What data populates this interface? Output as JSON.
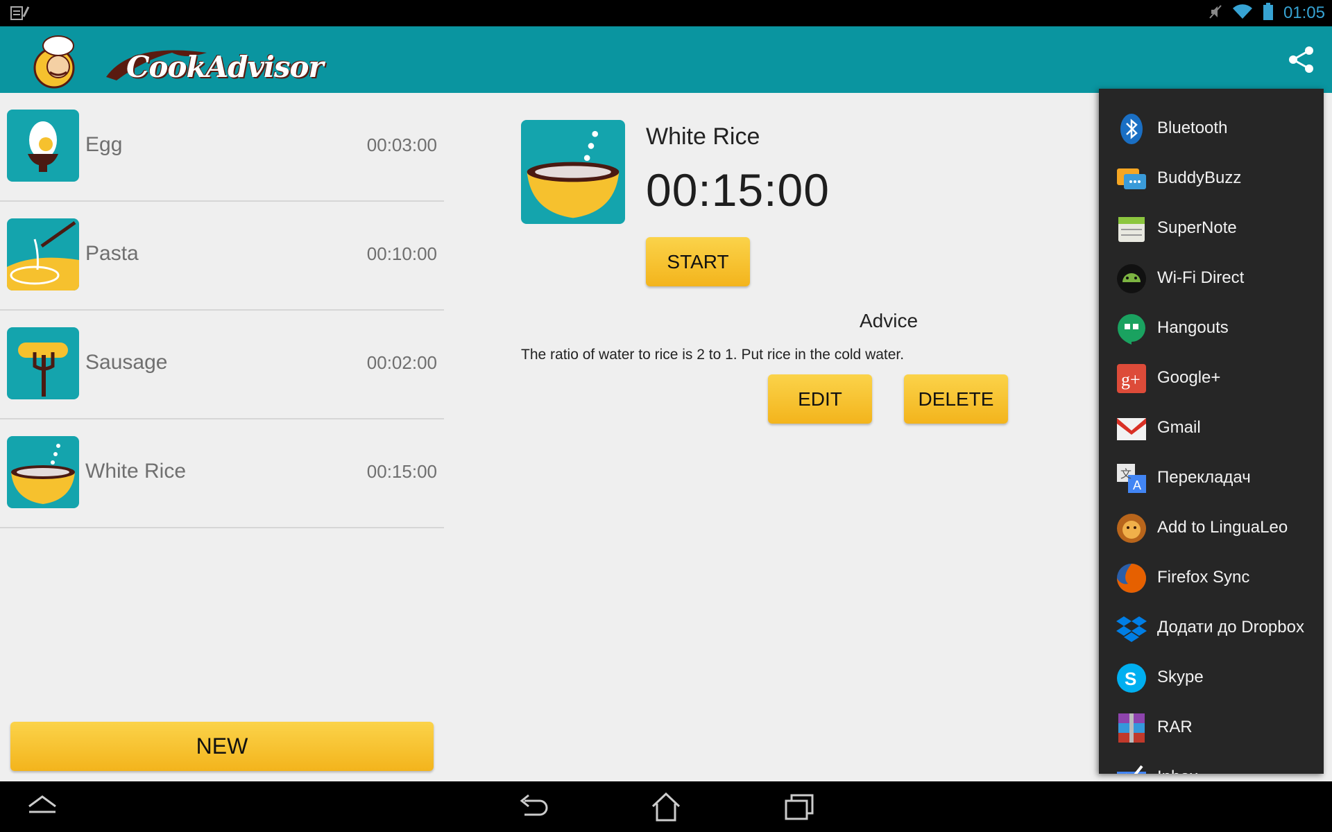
{
  "status_bar": {
    "time": "01:05"
  },
  "app_bar": {
    "title": "CookAdvisor"
  },
  "recipes": [
    {
      "name": "Egg",
      "time": "00:03:00",
      "icon": "egg-icon"
    },
    {
      "name": "Pasta",
      "time": "00:10:00",
      "icon": "pasta-icon"
    },
    {
      "name": "Sausage",
      "time": "00:02:00",
      "icon": "sausage-icon"
    },
    {
      "name": "White Rice",
      "time": "00:15:00",
      "icon": "rice-icon"
    }
  ],
  "new_button": "NEW",
  "detail": {
    "title": "White Rice",
    "timer": "00:15:00",
    "start_label": "START",
    "advice_label": "Advice",
    "advice_text": "The ratio of water to rice is 2 to 1. Put rice in the cold water.",
    "edit_label": "EDIT",
    "delete_label": "DELETE"
  },
  "share_menu": [
    {
      "label": "Bluetooth",
      "icon": "bluetooth-icon",
      "color": "#1a6fc4"
    },
    {
      "label": "BuddyBuzz",
      "icon": "buddybuzz-icon",
      "color": "#f5a623"
    },
    {
      "label": "SuperNote",
      "icon": "supernote-icon",
      "color": "#8cc63f"
    },
    {
      "label": "Wi-Fi Direct",
      "icon": "wifi-direct-icon",
      "color": "#7cb342"
    },
    {
      "label": "Hangouts",
      "icon": "hangouts-icon",
      "color": "#1aa260"
    },
    {
      "label": "Google+",
      "icon": "google-plus-icon",
      "color": "#dd4b39"
    },
    {
      "label": "Gmail",
      "icon": "gmail-icon",
      "color": "#d93025"
    },
    {
      "label": "Перекладач",
      "icon": "translate-icon",
      "color": "#4285f4"
    },
    {
      "label": "Add to LinguaLeo",
      "icon": "lingualeo-icon",
      "color": "#e08e1b"
    },
    {
      "label": "Firefox Sync",
      "icon": "firefox-icon",
      "color": "#e66000"
    },
    {
      "label": "Додати до Dropbox",
      "icon": "dropbox-icon",
      "color": "#007ee5"
    },
    {
      "label": "Skype",
      "icon": "skype-icon",
      "color": "#00aff0"
    },
    {
      "label": "RAR",
      "icon": "rar-icon",
      "color": "#8e44ad"
    },
    {
      "label": "Inbox",
      "icon": "inbox-icon",
      "color": "#4285f4"
    }
  ],
  "colors": {
    "app_bar": "#0a95a0",
    "button_yellow": "#f6c12e",
    "menu_bg": "#262626"
  }
}
